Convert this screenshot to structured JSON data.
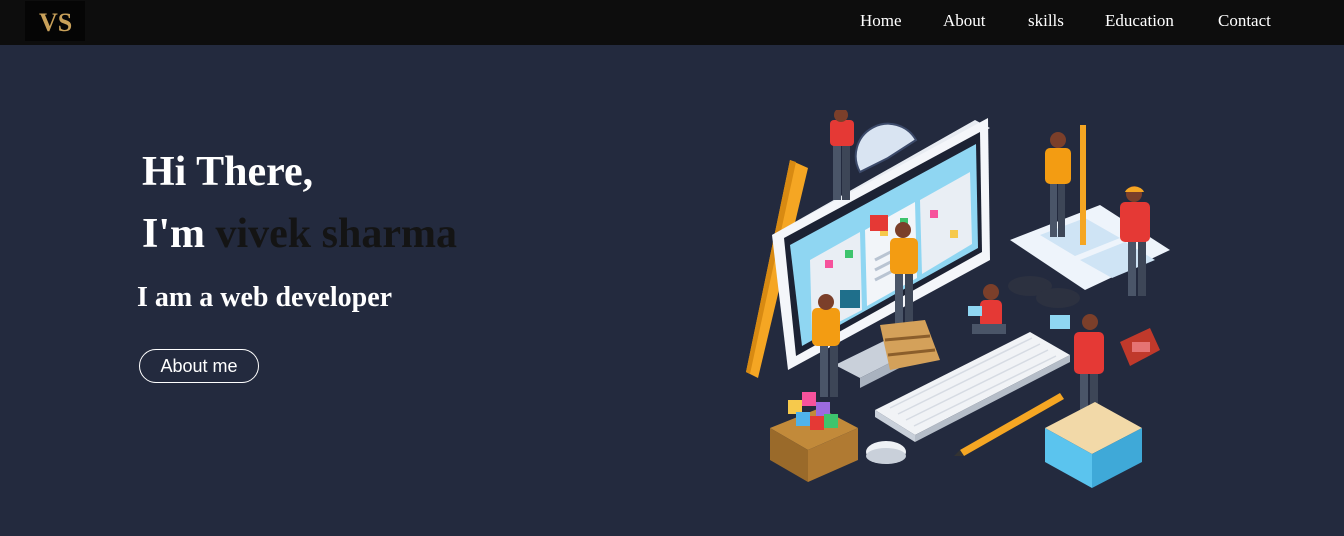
{
  "navbar": {
    "logo_text": "VS",
    "links": [
      {
        "label": "Home"
      },
      {
        "label": "About"
      },
      {
        "label": "skills"
      },
      {
        "label": "Education"
      },
      {
        "label": "Contact"
      }
    ]
  },
  "hero": {
    "greeting": "Hi There,",
    "intro_prefix": "I'm",
    "name": "vivek sharma",
    "tagline": "I am a web developer",
    "button_label": "About me",
    "illustration_icon": "web-development-team-illustration"
  },
  "colors": {
    "page_background": "#232a3e",
    "navbar_background": "#0d0d0d",
    "name_color": "#141414",
    "logo_gold": "#c9a15a",
    "text": "#ffffff"
  }
}
